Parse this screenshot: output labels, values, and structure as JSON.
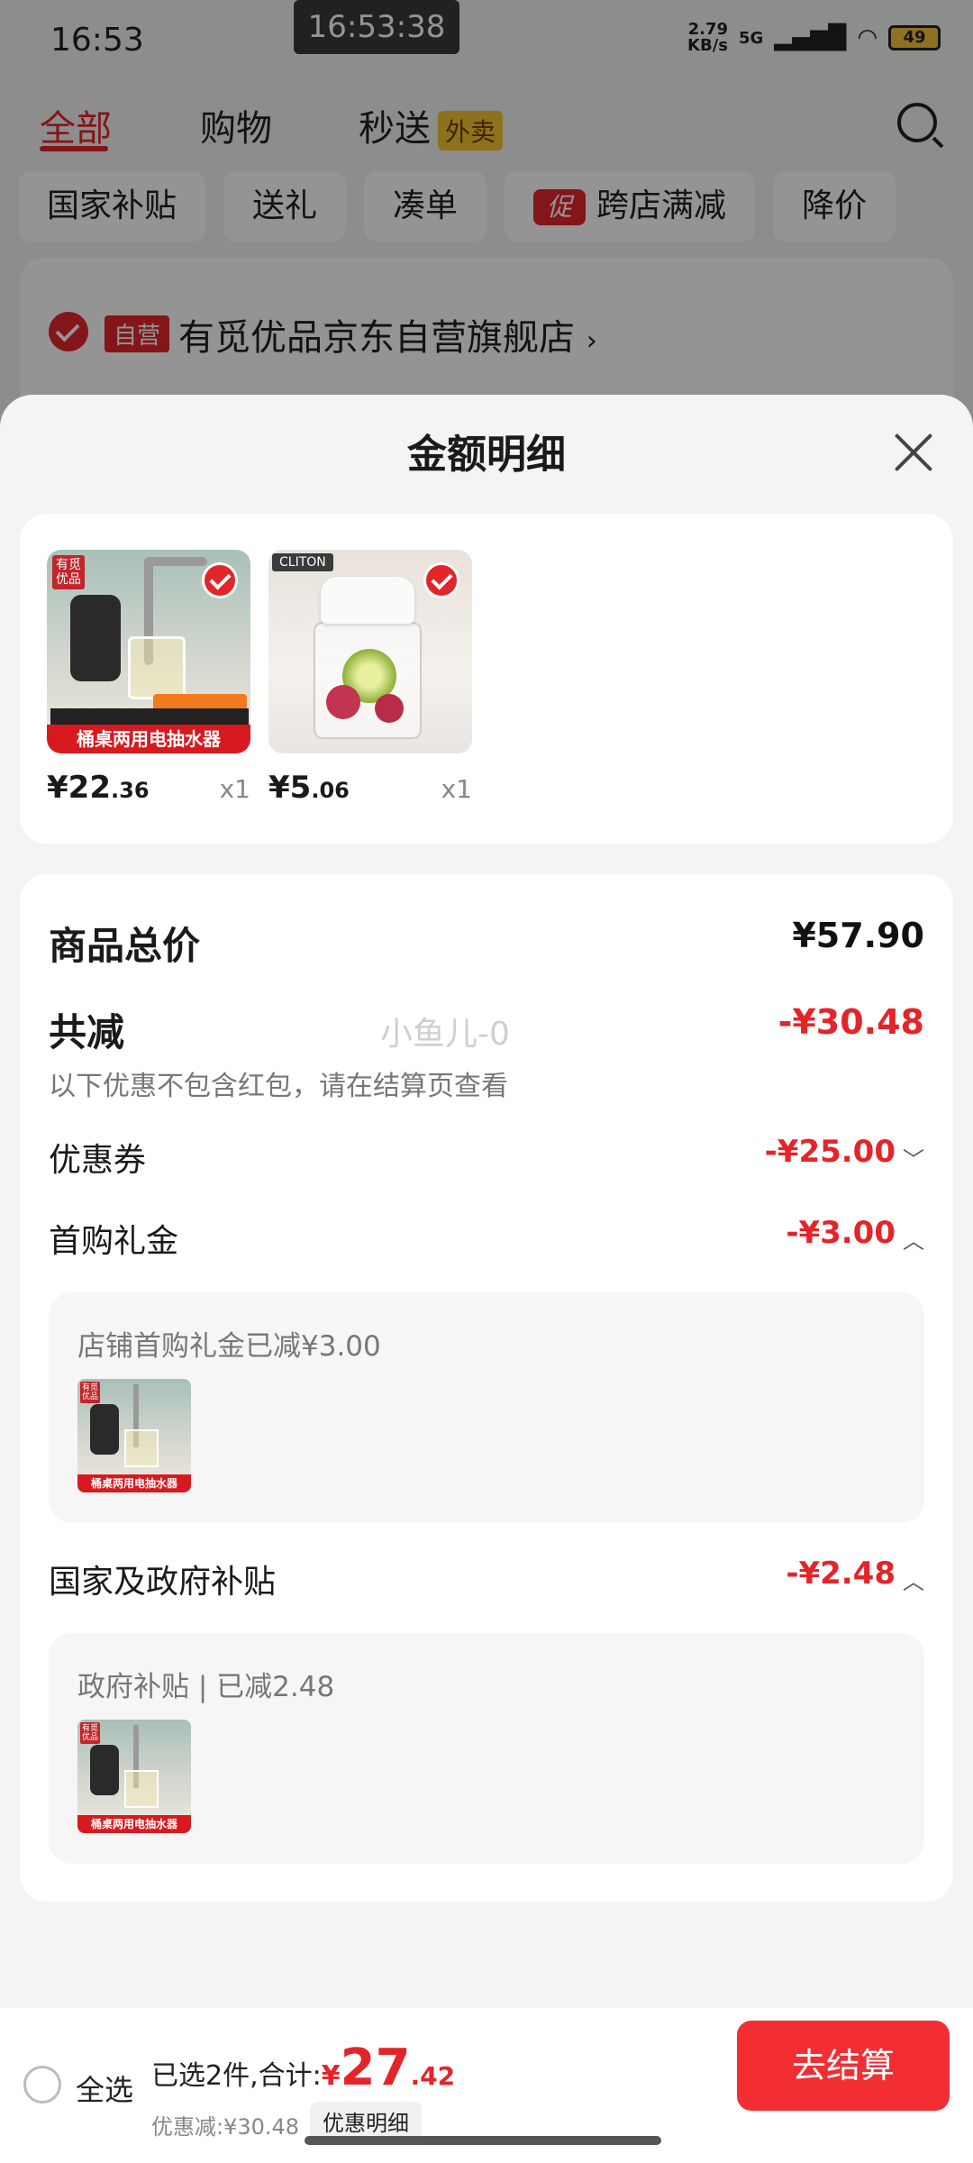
{
  "status_bar": {
    "time": "16:53",
    "center_time": "16:53:38",
    "net_speed": "2.79",
    "net_unit": "KB/s",
    "network": "5G",
    "battery": "49"
  },
  "top_tabs": [
    {
      "label": "全部"
    },
    {
      "label": "购物"
    },
    {
      "label": "秒送"
    }
  ],
  "waimai_badge": "外卖",
  "filter_chips": [
    "国家补贴",
    "送礼",
    "凑单",
    "跨店满减",
    "降价"
  ],
  "promo_badge": "促",
  "store": {
    "badge": "自营",
    "name": "有觅优品京东自营旗舰店",
    "arrow": "›"
  },
  "sheet": {
    "title": "金额明细",
    "products": [
      {
        "currency": "¥",
        "price_int": "22",
        "price_dec": ".36",
        "qty": "x1",
        "image_tag": "有觅\n优品",
        "banner": "桶桌两用电抽水器",
        "icon": "water-dispenser-product-image"
      },
      {
        "currency": "¥",
        "price_int": "5",
        "price_dec": ".06",
        "qty": "x1",
        "image_tag": "CLITON",
        "icon": "fruit-jar-product-image"
      }
    ],
    "total_label": "商品总价",
    "total_value": "¥57.90",
    "discount_label": "共减",
    "discount_value": "-¥30.48",
    "discount_note": "以下优惠不包含红包，请在结算页查看",
    "watermark": "小鱼儿-0",
    "coupon_label": "优惠券",
    "coupon_value": "-¥25.00",
    "gift_label": "首购礼金",
    "gift_value": "-¥3.00",
    "gift_detail": "店铺首购礼金已减¥3.00",
    "subsidy_label": "国家及政府补贴",
    "subsidy_value": "-¥2.48",
    "subsidy_detail": "政府补贴 | 已减2.48",
    "thumb_tag": "有觅\n优品",
    "thumb_banner": "桶桌两用电抽水器"
  },
  "bottom_bar": {
    "select_all": "全选",
    "selected_text": "已选2件,合计:",
    "currency": "¥",
    "total_int": "27",
    "total_dec": ".42",
    "saved_text": "优惠减:¥30.48",
    "detail_button": "优惠明细",
    "checkout_button": "去结算"
  },
  "colors": {
    "accent": "#e3252a",
    "checkout": "#f22e33"
  }
}
